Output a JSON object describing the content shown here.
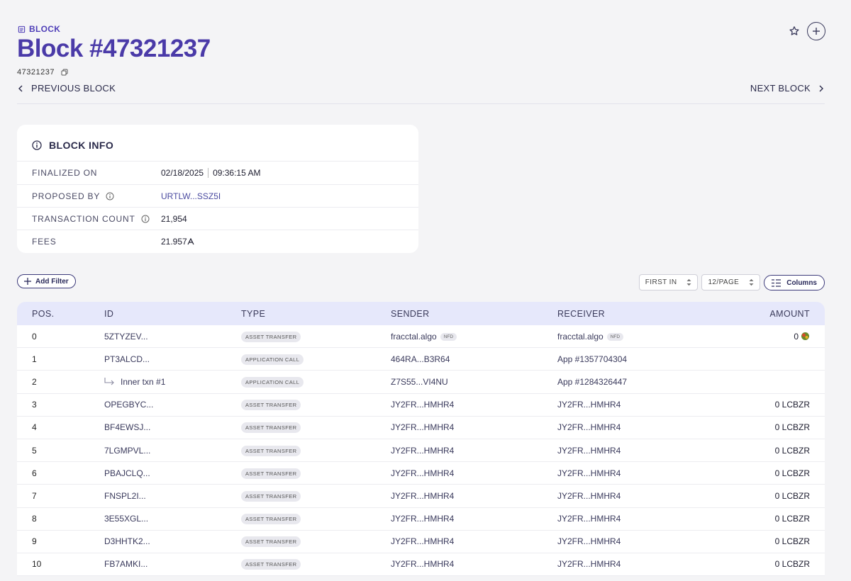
{
  "breadcrumb": {
    "label": "BLOCK"
  },
  "page": {
    "title": "Block #47321237",
    "block_id": "47321237"
  },
  "nav": {
    "prev_label": "PREVIOUS BLOCK",
    "next_label": "NEXT BLOCK"
  },
  "block_info": {
    "heading": "BLOCK INFO",
    "rows": [
      {
        "label": "FINALIZED ON",
        "date": "02/18/2025",
        "time": "09:36:15 AM"
      },
      {
        "label": "PROPOSED BY",
        "value": "URTLW...SSZ5I"
      },
      {
        "label": "TRANSACTION COUNT",
        "value": "21,954"
      },
      {
        "label": "FEES",
        "value": "21.957"
      }
    ]
  },
  "toolbar": {
    "add_filter_label": "Add Filter",
    "sort_value": "FIRST IN",
    "page_size_value": "12/PAGE",
    "columns_label": "Columns"
  },
  "table": {
    "headers": [
      "POS.",
      "ID",
      "TYPE",
      "SENDER",
      "RECEIVER",
      "AMOUNT"
    ],
    "rows": [
      {
        "pos": "0",
        "id": "5ZTYZEV...",
        "type": "ASSET TRANSFER",
        "sender": "fracctal.algo",
        "sender_tag": "NFD",
        "receiver": "fracctal.algo",
        "receiver_tag": "NFD",
        "amount": "0"
      },
      {
        "pos": "1",
        "id": "PT3ALCD...",
        "type": "APPLICATION CALL",
        "sender": "464RA...B3R64",
        "receiver": "App #1357704304",
        "amount": ""
      },
      {
        "pos": "2",
        "id": "Inner txn #1",
        "inner": true,
        "type": "APPLICATION CALL",
        "sender": "Z7S55...VI4NU",
        "receiver": "App #1284326447",
        "amount": ""
      },
      {
        "pos": "3",
        "id": "OPEGBYC...",
        "type": "ASSET TRANSFER",
        "sender": "JY2FR...HMHR4",
        "receiver": "JY2FR...HMHR4",
        "amount": "0 LCBZR"
      },
      {
        "pos": "4",
        "id": "BF4EWSJ...",
        "type": "ASSET TRANSFER",
        "sender": "JY2FR...HMHR4",
        "receiver": "JY2FR...HMHR4",
        "amount": "0 LCBZR"
      },
      {
        "pos": "5",
        "id": "7LGMPVL...",
        "type": "ASSET TRANSFER",
        "sender": "JY2FR...HMHR4",
        "receiver": "JY2FR...HMHR4",
        "amount": "0 LCBZR"
      },
      {
        "pos": "6",
        "id": "PBAJCLQ...",
        "type": "ASSET TRANSFER",
        "sender": "JY2FR...HMHR4",
        "receiver": "JY2FR...HMHR4",
        "amount": "0 LCBZR"
      },
      {
        "pos": "7",
        "id": "FNSPL2I...",
        "type": "ASSET TRANSFER",
        "sender": "JY2FR...HMHR4",
        "receiver": "JY2FR...HMHR4",
        "amount": "0 LCBZR"
      },
      {
        "pos": "8",
        "id": "3E55XGL...",
        "type": "ASSET TRANSFER",
        "sender": "JY2FR...HMHR4",
        "receiver": "JY2FR...HMHR4",
        "amount": "0 LCBZR"
      },
      {
        "pos": "9",
        "id": "D3HHTK2...",
        "type": "ASSET TRANSFER",
        "sender": "JY2FR...HMHR4",
        "receiver": "JY2FR...HMHR4",
        "amount": "0 LCBZR"
      },
      {
        "pos": "10",
        "id": "FB7AMKI...",
        "type": "ASSET TRANSFER",
        "sender": "JY2FR...HMHR4",
        "receiver": "JY2FR...HMHR4",
        "amount": "0 LCBZR"
      }
    ]
  },
  "colors": {
    "accent": "#4a3aa8",
    "header_bg": "#e6e8fb",
    "page_bg": "#f4f4f6"
  }
}
